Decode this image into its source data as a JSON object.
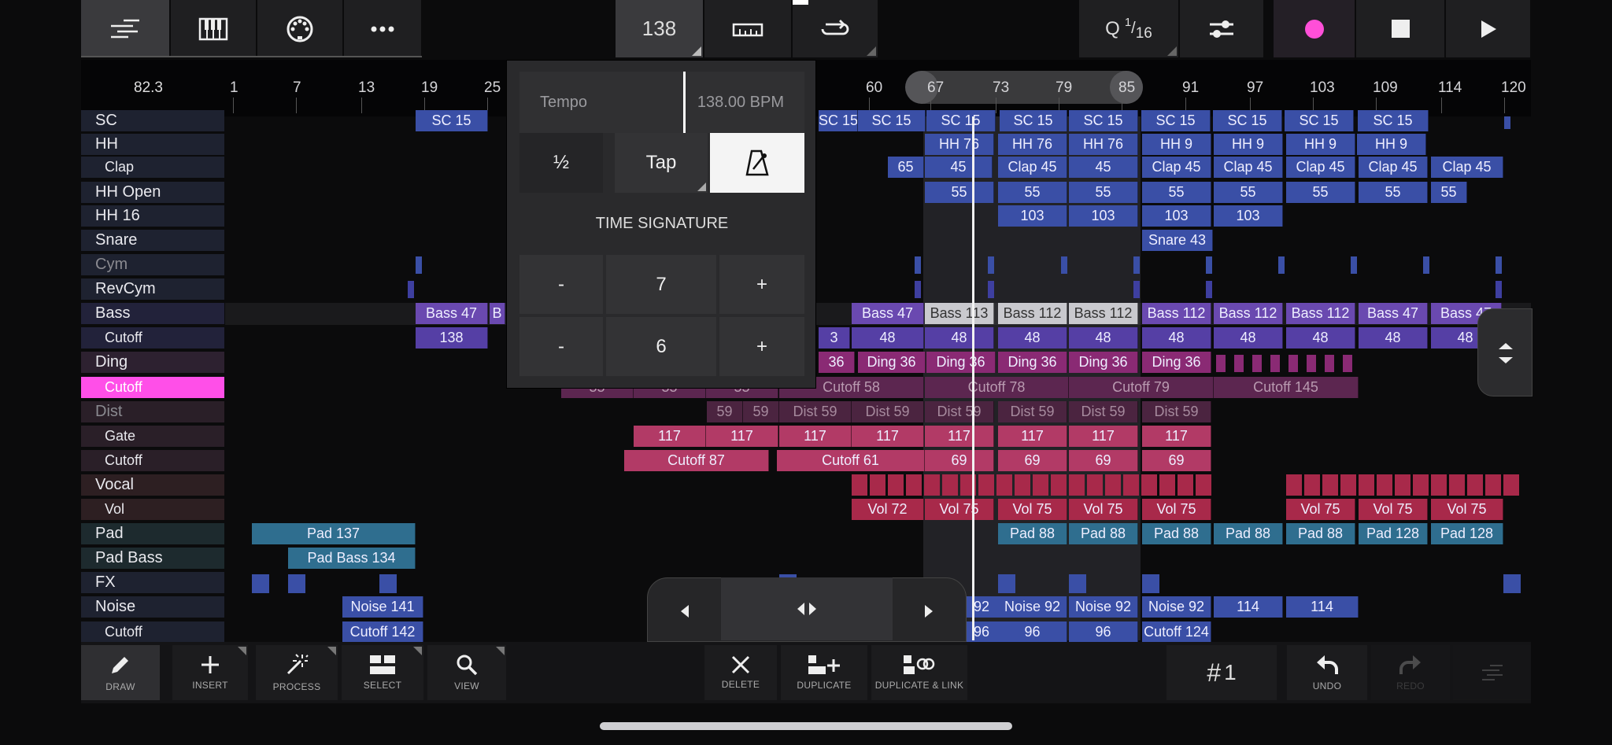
{
  "toolbar": {
    "tempo_value": "138",
    "quantize_label": "Q",
    "quantize_num": "1",
    "quantize_den": "16",
    "icons": [
      "tracks-icon",
      "piano-icon",
      "midi-icon",
      "more-icon",
      "ruler-icon",
      "loop-icon",
      "mixer-icon",
      "record-icon",
      "stop-icon",
      "play-icon"
    ]
  },
  "ruler": {
    "position": "82.3",
    "ticks": [
      "1",
      "7",
      "13",
      "19",
      "25",
      "60",
      "67",
      "73",
      "79",
      "85",
      "91",
      "97",
      "103",
      "109",
      "114",
      "120"
    ]
  },
  "lanes": [
    {
      "label": "SC",
      "sub": false
    },
    {
      "label": "HH",
      "sub": false
    },
    {
      "label": "Clap",
      "sub": true
    },
    {
      "label": "HH Open",
      "sub": false
    },
    {
      "label": "HH 16",
      "sub": false
    },
    {
      "label": "Snare",
      "sub": false
    },
    {
      "label": "Cym",
      "sub": false
    },
    {
      "label": "RevCym",
      "sub": false
    },
    {
      "label": "Bass",
      "sub": false
    },
    {
      "label": "Cutoff",
      "sub": true
    },
    {
      "label": "Ding",
      "sub": false
    },
    {
      "label": "Cutoff",
      "sub": true
    },
    {
      "label": "Dist",
      "sub": false
    },
    {
      "label": "Gate",
      "sub": true
    },
    {
      "label": "Cutoff",
      "sub": true
    },
    {
      "label": "Vocal",
      "sub": false
    },
    {
      "label": "Vol",
      "sub": true
    },
    {
      "label": "Pad",
      "sub": false
    },
    {
      "label": "Pad Bass",
      "sub": false
    },
    {
      "label": "FX",
      "sub": false
    },
    {
      "label": "Noise",
      "sub": false
    },
    {
      "label": "Cutoff",
      "sub": true
    }
  ],
  "clips": [
    {
      "t": "SC 15",
      "c": "blue"
    },
    {
      "t": "SC 15",
      "c": "blue"
    },
    {
      "t": "SC 15",
      "c": "blue"
    },
    {
      "t": "SC 15",
      "c": "blue"
    },
    {
      "t": "SC 15",
      "c": "blue"
    },
    {
      "t": "SC 15",
      "c": "blue"
    },
    {
      "t": "SC 15",
      "c": "blue"
    },
    {
      "t": "SC 15",
      "c": "blue"
    },
    {
      "t": "SC 15",
      "c": "blue"
    },
    {
      "t": "SC 15",
      "c": "blue"
    },
    {
      "t": "HH 76",
      "c": "blue"
    },
    {
      "t": "HH 76",
      "c": "blue"
    },
    {
      "t": "HH 76",
      "c": "blue"
    },
    {
      "t": "HH 9",
      "c": "blue"
    },
    {
      "t": "HH 9",
      "c": "blue"
    },
    {
      "t": "HH 9",
      "c": "blue"
    },
    {
      "t": "HH 9",
      "c": "blue"
    },
    {
      "t": "65",
      "c": "blue"
    },
    {
      "t": "45",
      "c": "blue"
    },
    {
      "t": "Clap 45",
      "c": "blue"
    },
    {
      "t": "45",
      "c": "blue"
    },
    {
      "t": "Clap 45",
      "c": "blue"
    },
    {
      "t": "Clap 45",
      "c": "blue"
    },
    {
      "t": "Clap 45",
      "c": "blue"
    },
    {
      "t": "Clap 45",
      "c": "blue"
    },
    {
      "t": "Clap 45",
      "c": "blue"
    },
    {
      "t": "55",
      "c": "blue"
    },
    {
      "t": "55",
      "c": "blue"
    },
    {
      "t": "55",
      "c": "blue"
    },
    {
      "t": "55",
      "c": "blue"
    },
    {
      "t": "55",
      "c": "blue"
    },
    {
      "t": "55",
      "c": "blue"
    },
    {
      "t": "55",
      "c": "blue"
    },
    {
      "t": "55",
      "c": "blue"
    },
    {
      "t": "103",
      "c": "blue"
    },
    {
      "t": "103",
      "c": "blue"
    },
    {
      "t": "103",
      "c": "blue"
    },
    {
      "t": "103",
      "c": "blue"
    },
    {
      "t": "Snare 43",
      "c": "blue"
    },
    {
      "t": "Bass 47",
      "c": "purple"
    },
    {
      "t": "B",
      "c": "purple"
    },
    {
      "t": "Bass 47",
      "c": "purple"
    },
    {
      "t": "Bass 113",
      "c": "gray"
    },
    {
      "t": "Bass 112",
      "c": "gray"
    },
    {
      "t": "Bass 112",
      "c": "gray"
    },
    {
      "t": "Bass 112",
      "c": "purple"
    },
    {
      "t": "Bass 112",
      "c": "purple"
    },
    {
      "t": "Bass 112",
      "c": "purple"
    },
    {
      "t": "Bass 47",
      "c": "purple"
    },
    {
      "t": "Bass 47",
      "c": "purple"
    },
    {
      "t": "138",
      "c": "violet"
    },
    {
      "t": "3",
      "c": "violet"
    },
    {
      "t": "48",
      "c": "violet"
    },
    {
      "t": "48",
      "c": "violet"
    },
    {
      "t": "48",
      "c": "violet"
    },
    {
      "t": "48",
      "c": "violet"
    },
    {
      "t": "48",
      "c": "violet"
    },
    {
      "t": "48",
      "c": "violet"
    },
    {
      "t": "48",
      "c": "violet"
    },
    {
      "t": "48",
      "c": "violet"
    },
    {
      "t": "48",
      "c": "violet"
    },
    {
      "t": "36",
      "c": "mag"
    },
    {
      "t": "Ding 36",
      "c": "mag"
    },
    {
      "t": "Ding 36",
      "c": "mag"
    },
    {
      "t": "Ding 36",
      "c": "mag"
    },
    {
      "t": "Ding 36",
      "c": "mag"
    },
    {
      "t": "Ding 36",
      "c": "mag"
    },
    {
      "t": "55",
      "c": "dmag"
    },
    {
      "t": "55",
      "c": "dmag"
    },
    {
      "t": "55",
      "c": "dmag"
    },
    {
      "t": "Cutoff 58",
      "c": "dmag"
    },
    {
      "t": "Cutoff 78",
      "c": "dmag"
    },
    {
      "t": "Cutoff 79",
      "c": "dmag"
    },
    {
      "t": "Cutoff 145",
      "c": "dmag"
    },
    {
      "t": "59",
      "c": "dmag2"
    },
    {
      "t": "59",
      "c": "dmag2"
    },
    {
      "t": "Dist 59",
      "c": "dmag2"
    },
    {
      "t": "Dist 59",
      "c": "dmag2"
    },
    {
      "t": "Dist 59",
      "c": "dmag2"
    },
    {
      "t": "Dist 59",
      "c": "dmag2"
    },
    {
      "t": "Dist 59",
      "c": "dmag2"
    },
    {
      "t": "Dist 59",
      "c": "dmag2"
    },
    {
      "t": "117",
      "c": "pink"
    },
    {
      "t": "117",
      "c": "pink"
    },
    {
      "t": "117",
      "c": "pink"
    },
    {
      "t": "117",
      "c": "pink"
    },
    {
      "t": "117",
      "c": "pink"
    },
    {
      "t": "117",
      "c": "pink"
    },
    {
      "t": "117",
      "c": "pink"
    },
    {
      "t": "117",
      "c": "pink"
    },
    {
      "t": "Cutoff 87",
      "c": "pink"
    },
    {
      "t": "Cutoff 61",
      "c": "pink"
    },
    {
      "t": "69",
      "c": "pink"
    },
    {
      "t": "69",
      "c": "pink"
    },
    {
      "t": "69",
      "c": "pink"
    },
    {
      "t": "69",
      "c": "pink"
    },
    {
      "t": "Vol 72",
      "c": "red"
    },
    {
      "t": "Vol 75",
      "c": "red"
    },
    {
      "t": "Vol 75",
      "c": "red"
    },
    {
      "t": "Vol 75",
      "c": "red"
    },
    {
      "t": "Vol 75",
      "c": "red"
    },
    {
      "t": "Vol 75",
      "c": "red"
    },
    {
      "t": "Vol 75",
      "c": "red"
    },
    {
      "t": "Vol 75",
      "c": "red"
    },
    {
      "t": "Pad 137",
      "c": "teal"
    },
    {
      "t": "Pad 88",
      "c": "teal"
    },
    {
      "t": "Pad 88",
      "c": "teal"
    },
    {
      "t": "Pad 88",
      "c": "teal"
    },
    {
      "t": "Pad 88",
      "c": "teal"
    },
    {
      "t": "Pad 88",
      "c": "teal"
    },
    {
      "t": "Pad 128",
      "c": "teal"
    },
    {
      "t": "Pad 128",
      "c": "teal"
    },
    {
      "t": "Pad Bass 134",
      "c": "teal"
    },
    {
      "t": "Noise 141",
      "c": "blue"
    },
    {
      "t": "92",
      "c": "blue"
    },
    {
      "t": "Noise 92",
      "c": "blue"
    },
    {
      "t": "Noise 92",
      "c": "blue"
    },
    {
      "t": "Noise 92",
      "c": "blue"
    },
    {
      "t": "114",
      "c": "blue"
    },
    {
      "t": "114",
      "c": "blue"
    },
    {
      "t": "Cutoff 142",
      "c": "blue"
    },
    {
      "t": "96",
      "c": "blue"
    },
    {
      "t": "96",
      "c": "blue"
    },
    {
      "t": "96",
      "c": "blue"
    },
    {
      "t": "Cutoff 124",
      "c": "blue"
    }
  ],
  "tempo_panel": {
    "tempo_label": "Tempo",
    "bpm": "138.00 BPM",
    "half": "½",
    "tap": "Tap",
    "time_sig_heading": "TIME SIGNATURE",
    "minus": "-",
    "plus": "+",
    "numerator": "7",
    "denominator": "6"
  },
  "bottom": {
    "draw": "DRAW",
    "insert": "INSERT",
    "process": "PROCESS",
    "select": "SELECT",
    "view": "VIEW",
    "delete": "DELETE",
    "duplicate": "DUPLICATE",
    "duplicate_link": "DUPLICATE & LINK",
    "grid": "1",
    "undo": "UNDO",
    "redo": "REDO"
  },
  "colors": {
    "record": "#ff4fd8",
    "selected_lane": "#ff3fe0"
  }
}
